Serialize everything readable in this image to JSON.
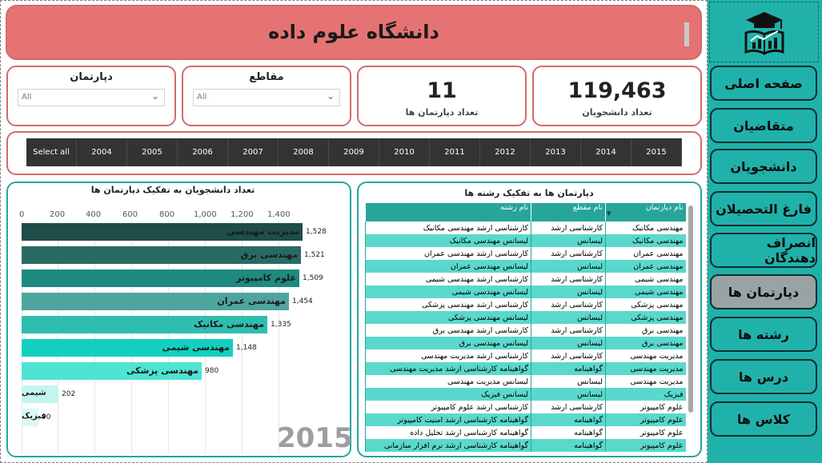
{
  "header": {
    "title": "دانشگاه علوم داده"
  },
  "slicers": {
    "department": {
      "label": "دپارتمان",
      "value": "All"
    },
    "level": {
      "label": "مقاطع",
      "value": "All"
    }
  },
  "kpis": {
    "departments": {
      "value": "11",
      "label": "تعداد دپارتمان ها"
    },
    "students": {
      "value": "119,463",
      "label": "تعداد دانشجویان"
    }
  },
  "years": [
    "Select all",
    "2004",
    "2005",
    "2006",
    "2007",
    "2008",
    "2009",
    "2010",
    "2011",
    "2012",
    "2013",
    "2014",
    "2015"
  ],
  "bar_chart": {
    "title": "تعداد دانشجویان به تفکیک دپارتمان ها",
    "watermark": "2015",
    "ticks": [
      "0",
      "200",
      "400",
      "600",
      "800",
      "1,000",
      "1,200",
      "1,400"
    ],
    "value_labels": [
      "1,528",
      "1,521",
      "1,509",
      "1,454",
      "1,335",
      "1,148",
      "980",
      "202",
      "90"
    ]
  },
  "chart_data": {
    "type": "bar",
    "title": "تعداد دانشجویان به تفکیک دپارتمان ها",
    "orientation": "horizontal",
    "categories": [
      "مدیریت مهندسی",
      "مهندسی برق",
      "علوم کامپیوتر",
      "مهندسی عمران",
      "مهندسی مکانیک",
      "مهندسی شیمی",
      "مهندسی پزشکی",
      "شیمی",
      "فیزیک"
    ],
    "values": [
      1528,
      1521,
      1509,
      1454,
      1335,
      1148,
      980,
      202,
      90
    ],
    "colors": [
      "#1e4d4a",
      "#2a6a65",
      "#1f8a80",
      "#4ea59e",
      "#2fbdaf",
      "#12d0c0",
      "#4fe3d4",
      "#c3f5f0",
      "#dcf8f5"
    ],
    "xlim": [
      0,
      1528
    ],
    "grid": true
  },
  "table": {
    "title": "دپارتمان ها به تفکیک رشته ها",
    "columns": [
      "نام دپارتمان",
      "نام مقطع",
      "نام رشته"
    ],
    "rows": [
      [
        "مهندسی مکانیک",
        "کارشناسی ارشد",
        "کارشناسی ارشد مهندسی مکانیک"
      ],
      [
        "مهندسی مکانیک",
        "لیسانس",
        "لیسانس مهندسی مکانیک"
      ],
      [
        "مهندسی عمران",
        "کارشناسی ارشد",
        "کارشناسی ارشد مهندسی عمران"
      ],
      [
        "مهندسی عمران",
        "لیسانس",
        "لیسانس مهندسی عمران"
      ],
      [
        "مهندسی شیمی",
        "کارشناسی ارشد",
        "کارشناسی ارشد مهندسی شیمی"
      ],
      [
        "مهندسی شیمی",
        "لیسانس",
        "لیسانس مهندسی شیمی"
      ],
      [
        "مهندسی پزشکی",
        "کارشناسی ارشد",
        "کارشناسی ارشد مهندسی پزشکی"
      ],
      [
        "مهندسی پزشکی",
        "لیسانس",
        "لیسانس مهندسی پزشکی"
      ],
      [
        "مهندسی برق",
        "کارشناسی ارشد",
        "کارشناسی ارشد مهندسی برق"
      ],
      [
        "مهندسی برق",
        "لیسانس",
        "لیسانس مهندسی برق"
      ],
      [
        "مدیریت مهندسی",
        "کارشناسی ارشد",
        "کارشناسی ارشد مدیریت مهندسی"
      ],
      [
        "مدیریت مهندسی",
        "گواهینامه",
        "گواهینامه کارشناسی ارشد مدیریت مهندسی"
      ],
      [
        "مدیریت مهندسی",
        "لیسانس",
        "لیسانس مدیریت مهندسی"
      ],
      [
        "فیزیک",
        "لیسانس",
        "لیسانس فیزیک"
      ],
      [
        "علوم کامپیوتر",
        "کارشناسی ارشد",
        "کارشناسی ارشد علوم کامپیوتر"
      ],
      [
        "علوم کامپیوتر",
        "گواهینامه",
        "گواهینامه کارشناسی ارشد امنیت کامپیوتر"
      ],
      [
        "علوم کامپیوتر",
        "گواهینامه",
        "گواهینامه کارشناسی ارشد تحلیل داده"
      ],
      [
        "علوم کامپیوتر",
        "گواهینامه",
        "گواهینامه کارشناسی ارشد نرم افزار سازمانی"
      ]
    ]
  },
  "nav": {
    "items": [
      {
        "label": "صفحه اصلی",
        "active": false
      },
      {
        "label": "متقاضیان",
        "active": false
      },
      {
        "label": "دانشجویان",
        "active": false
      },
      {
        "label": "فارغ التحصیلان",
        "active": false
      },
      {
        "label": "انصراف دهندگان",
        "active": false
      },
      {
        "label": "دپارتمان ها",
        "active": true
      },
      {
        "label": "رشته ها",
        "active": false
      },
      {
        "label": "درس ها",
        "active": false
      },
      {
        "label": "کلاس ها",
        "active": false
      }
    ]
  },
  "icons": {
    "logo": "graduation-cap-book-chart-icon",
    "dropdown": "chevron-down-icon",
    "sort": "sort-descending-icon"
  },
  "colors": {
    "header": "#e57373",
    "accent": "#20b2aa",
    "table_header": "#26a69a",
    "table_row_alt": "#5ad8cc",
    "year_button": "#333333"
  }
}
